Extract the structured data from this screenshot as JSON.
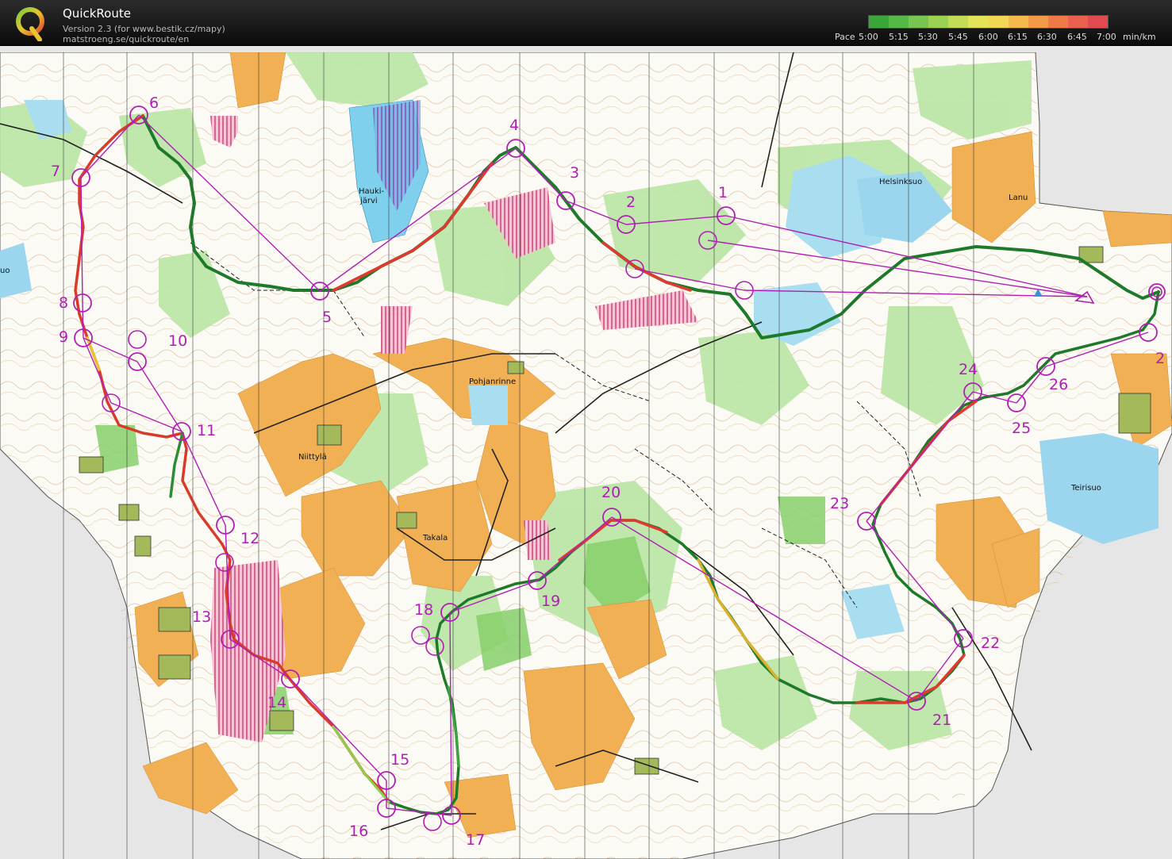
{
  "app": {
    "title": "QuickRoute",
    "version": "Version 2.3  (for www.bestik.cz/mapy)",
    "url": "matstroeng.se/quickroute/en",
    "logo_icon": "quickroute-q-logo"
  },
  "pace_legend": {
    "prefix": "Pace",
    "ticks": [
      "5:00",
      "5:15",
      "5:30",
      "5:45",
      "6:00",
      "6:15",
      "6:30",
      "6:45",
      "7:00"
    ],
    "unit": "min/km",
    "colors": [
      "#3aa63a",
      "#56b847",
      "#78c64f",
      "#9bd254",
      "#c2dc57",
      "#e3e35a",
      "#f2d655",
      "#f5b94e",
      "#f39a48",
      "#ef7a47",
      "#ea5f4d",
      "#e24a52"
    ]
  },
  "map": {
    "colors": {
      "open": "#f2a94d",
      "forest": "#ffffff",
      "green": "#9ad97f",
      "lightgreen": "#cdeebd",
      "water": "#7fd0ec",
      "marsh": "#a8def0",
      "course": "#b01fb5",
      "route_fast": "#1e7a2a",
      "route_slow": "#e03a2e"
    },
    "places": [
      "Hauki-",
      "järvi",
      "Helsinksuo",
      "Lanu",
      "Pohjanrinne",
      "Niittylä",
      "Takala",
      "Teirisuo",
      "uo"
    ],
    "controls": [
      "1",
      "2",
      "3",
      "4",
      "5",
      "6",
      "7",
      "8",
      "9",
      "10",
      "11",
      "12",
      "13",
      "14",
      "15",
      "16",
      "17",
      "18",
      "19",
      "20",
      "21",
      "22",
      "23",
      "24",
      "25",
      "26",
      "2"
    ]
  }
}
